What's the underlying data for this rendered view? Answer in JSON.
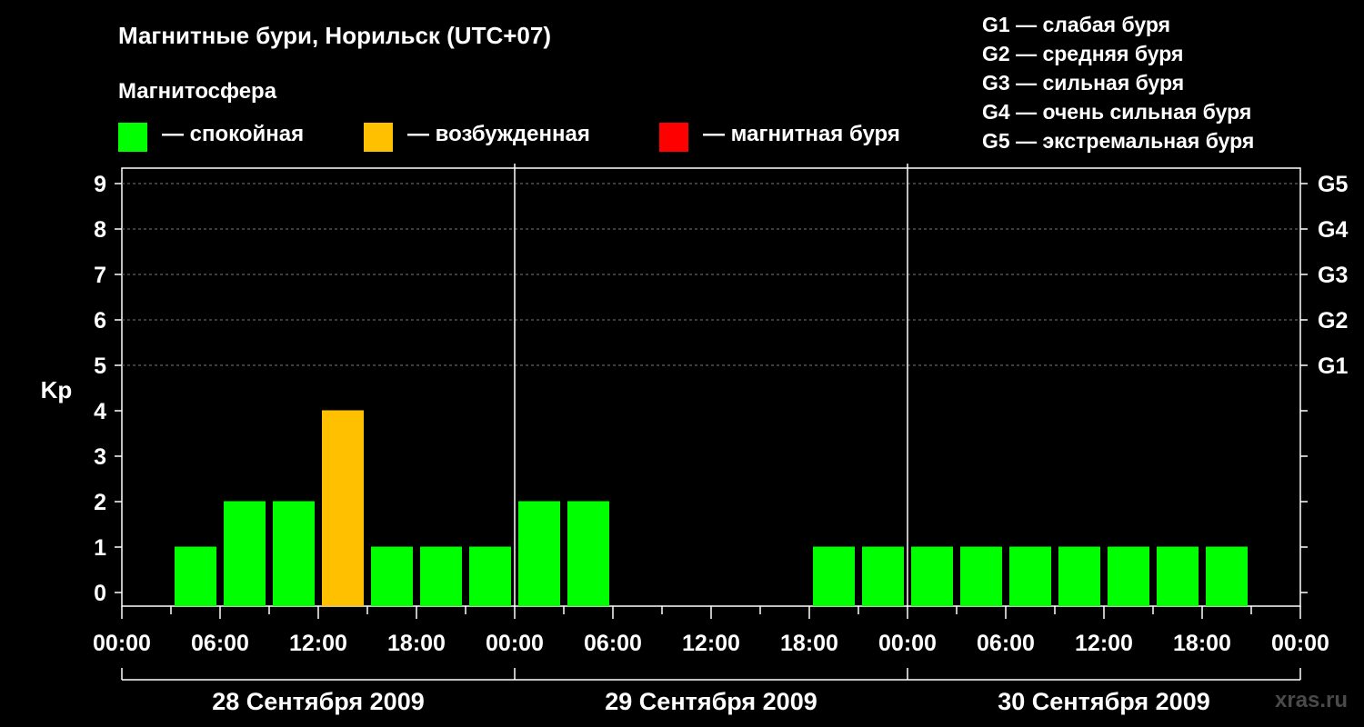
{
  "title": "Магнитные бури, Норильск (UTC+07)",
  "subtitle": "Магнитосфера",
  "legend": [
    {
      "label": "— спокойная",
      "color": "#00ff00"
    },
    {
      "label": "— возбужденная",
      "color": "#ffc000"
    },
    {
      "label": "— магнитная буря",
      "color": "#ff0000"
    }
  ],
  "g_legend": [
    "G1 — слабая буря",
    "G2 — средняя буря",
    "G3 — сильная буря",
    "G4 — очень сильная буря",
    "G5 — экстремальная буря"
  ],
  "watermark": "xras.ru",
  "chart_data": {
    "type": "bar",
    "ylabel": "Kp",
    "ylim": [
      0,
      9
    ],
    "yticks": [
      "0",
      "1",
      "2",
      "3",
      "4",
      "5",
      "6",
      "7",
      "8",
      "9"
    ],
    "right_ticks": [
      {
        "kp": 5,
        "label": "G1"
      },
      {
        "kp": 6,
        "label": "G2"
      },
      {
        "kp": 7,
        "label": "G3"
      },
      {
        "kp": 8,
        "label": "G4"
      },
      {
        "kp": 9,
        "label": "G5"
      }
    ],
    "xtick_labels": [
      "00:00",
      "06:00",
      "12:00",
      "18:00",
      "00:00",
      "06:00",
      "12:00",
      "18:00",
      "00:00",
      "06:00",
      "12:00",
      "18:00",
      "00:00"
    ],
    "days": [
      "28 Сентября 2009",
      "29 Сентября 2009",
      "30 Сентября 2009"
    ],
    "interval_hours": 3,
    "values": [
      null,
      1,
      2,
      2,
      4,
      1,
      1,
      1,
      2,
      2,
      null,
      null,
      null,
      null,
      1,
      1,
      1,
      1,
      1,
      1,
      1,
      1,
      1,
      null
    ],
    "colors": {
      "quiet": "#00ff00",
      "active": "#ffc000",
      "storm": "#ff0000"
    },
    "grid": true
  }
}
